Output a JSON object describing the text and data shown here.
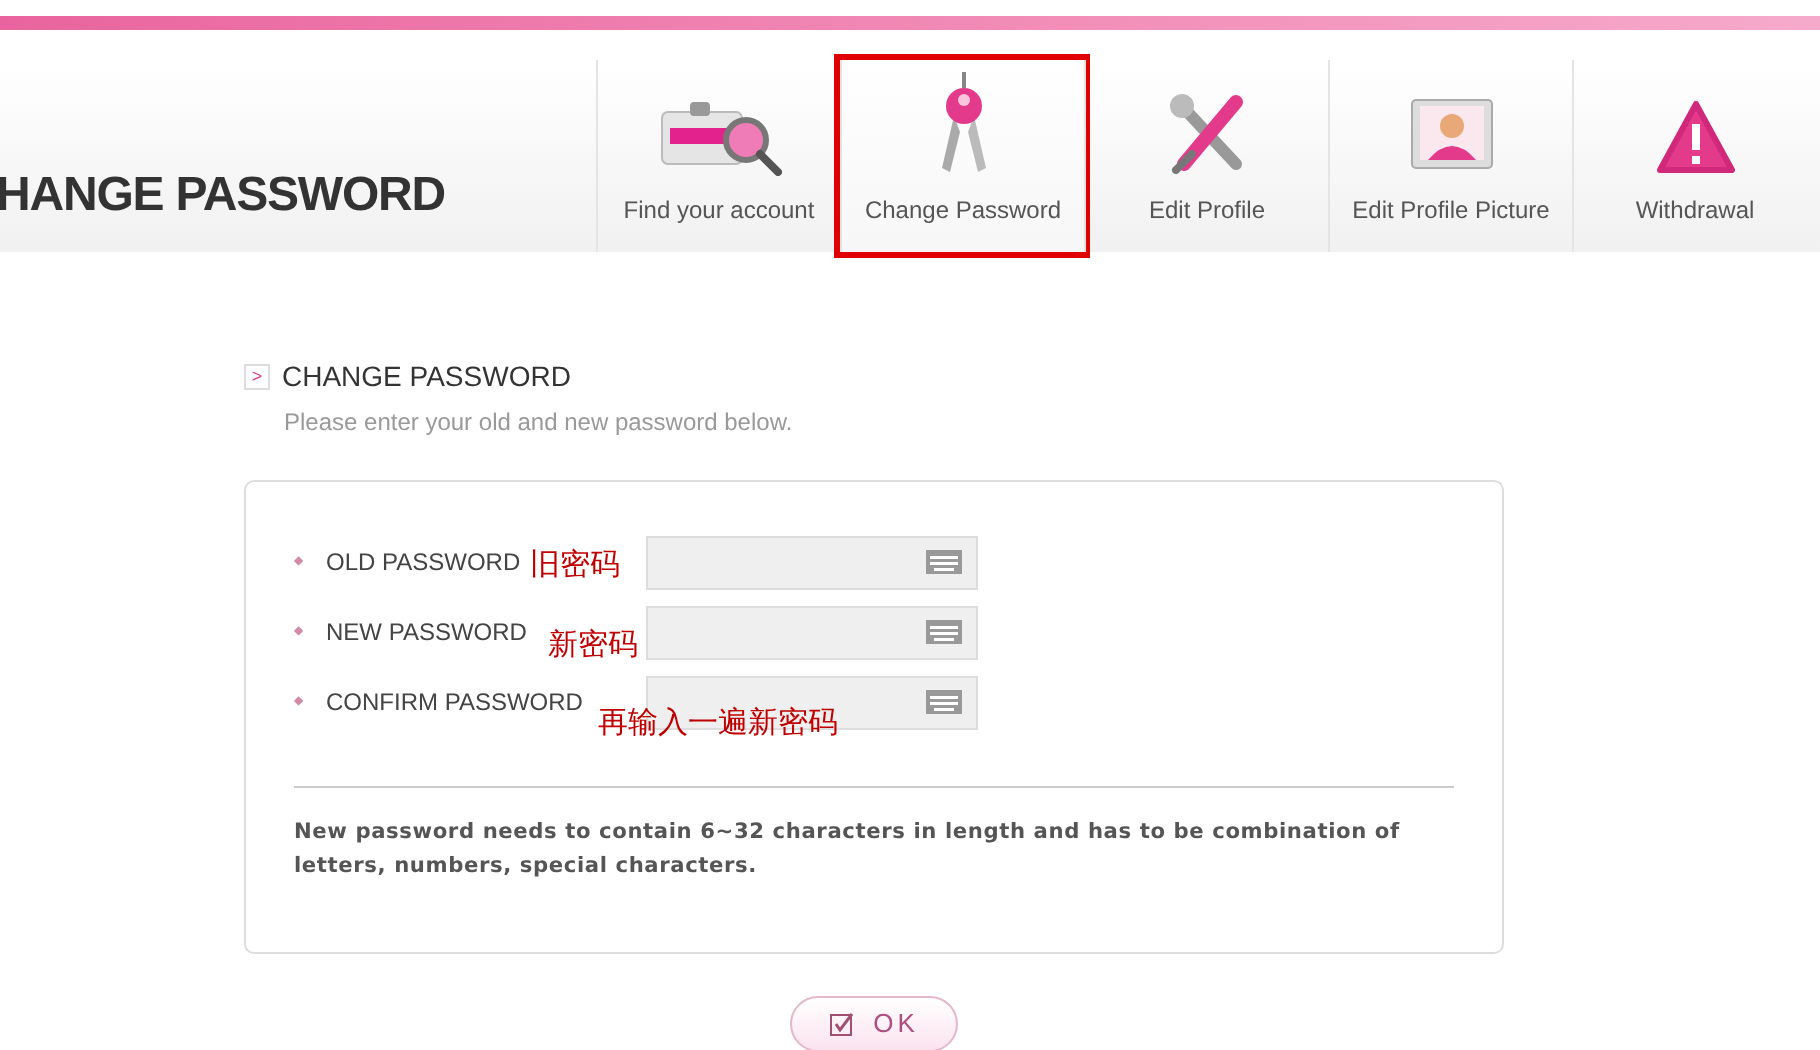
{
  "page_title": "HANGE PASSWORD",
  "tabs": [
    {
      "label": "Find your account",
      "kind": "account",
      "selected": false
    },
    {
      "label": "Change Password",
      "kind": "keys",
      "selected": true
    },
    {
      "label": "Edit Profile",
      "kind": "tools",
      "selected": false
    },
    {
      "label": "Edit Profile Picture",
      "kind": "portrait",
      "selected": false
    },
    {
      "label": "Withdrawal",
      "kind": "warning",
      "selected": false
    }
  ],
  "section": {
    "arrow": ">",
    "title": "CHANGE PASSWORD",
    "subtitle": "Please enter your old and new password below."
  },
  "fields": [
    {
      "bullet": "◆",
      "label": "OLD PASSWORD",
      "note": "旧密码"
    },
    {
      "bullet": "◆",
      "label": "NEW PASSWORD",
      "note": "新密码"
    },
    {
      "bullet": "◆",
      "label": "CONFIRM PASSWORD",
      "note": "再输入一遍新密码"
    }
  ],
  "notice": "New password needs to contain 6~32 characters in length and has to be combination of letters, numbers, special characters.",
  "ok_button": "OK"
}
